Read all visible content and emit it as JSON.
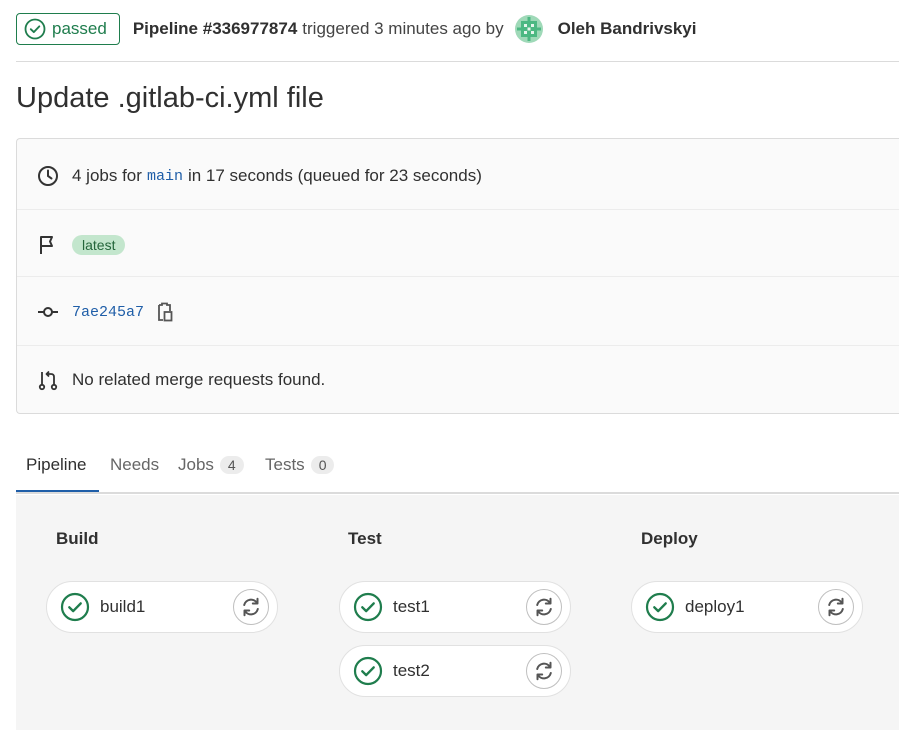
{
  "header": {
    "status": "passed",
    "pipeline_id": "Pipeline #336977874",
    "triggered_text": "triggered 3 minutes ago by",
    "author": "Oleh Bandrivskyi"
  },
  "title": "Update .gitlab-ci.yml file",
  "info": {
    "jobs_prefix": "4 jobs for",
    "branch": "main",
    "jobs_suffix": "in 17 seconds (queued for 23 seconds)",
    "tag": "latest",
    "commit_sha": "7ae245a7",
    "merge_requests": "No related merge requests found."
  },
  "tabs": [
    {
      "label": "Pipeline"
    },
    {
      "label": "Needs"
    },
    {
      "label": "Jobs",
      "count": "4"
    },
    {
      "label": "Tests",
      "count": "0"
    }
  ],
  "stages": [
    {
      "name": "Build",
      "jobs": [
        {
          "name": "build1",
          "status": "passed"
        }
      ]
    },
    {
      "name": "Test",
      "jobs": [
        {
          "name": "test1",
          "status": "passed"
        },
        {
          "name": "test2",
          "status": "passed"
        }
      ]
    },
    {
      "name": "Deploy",
      "jobs": [
        {
          "name": "deploy1",
          "status": "passed"
        }
      ]
    }
  ],
  "colors": {
    "success": "#1f7d4d",
    "link": "#1f5ea8",
    "latest_badge_bg": "#c3e6cd"
  }
}
